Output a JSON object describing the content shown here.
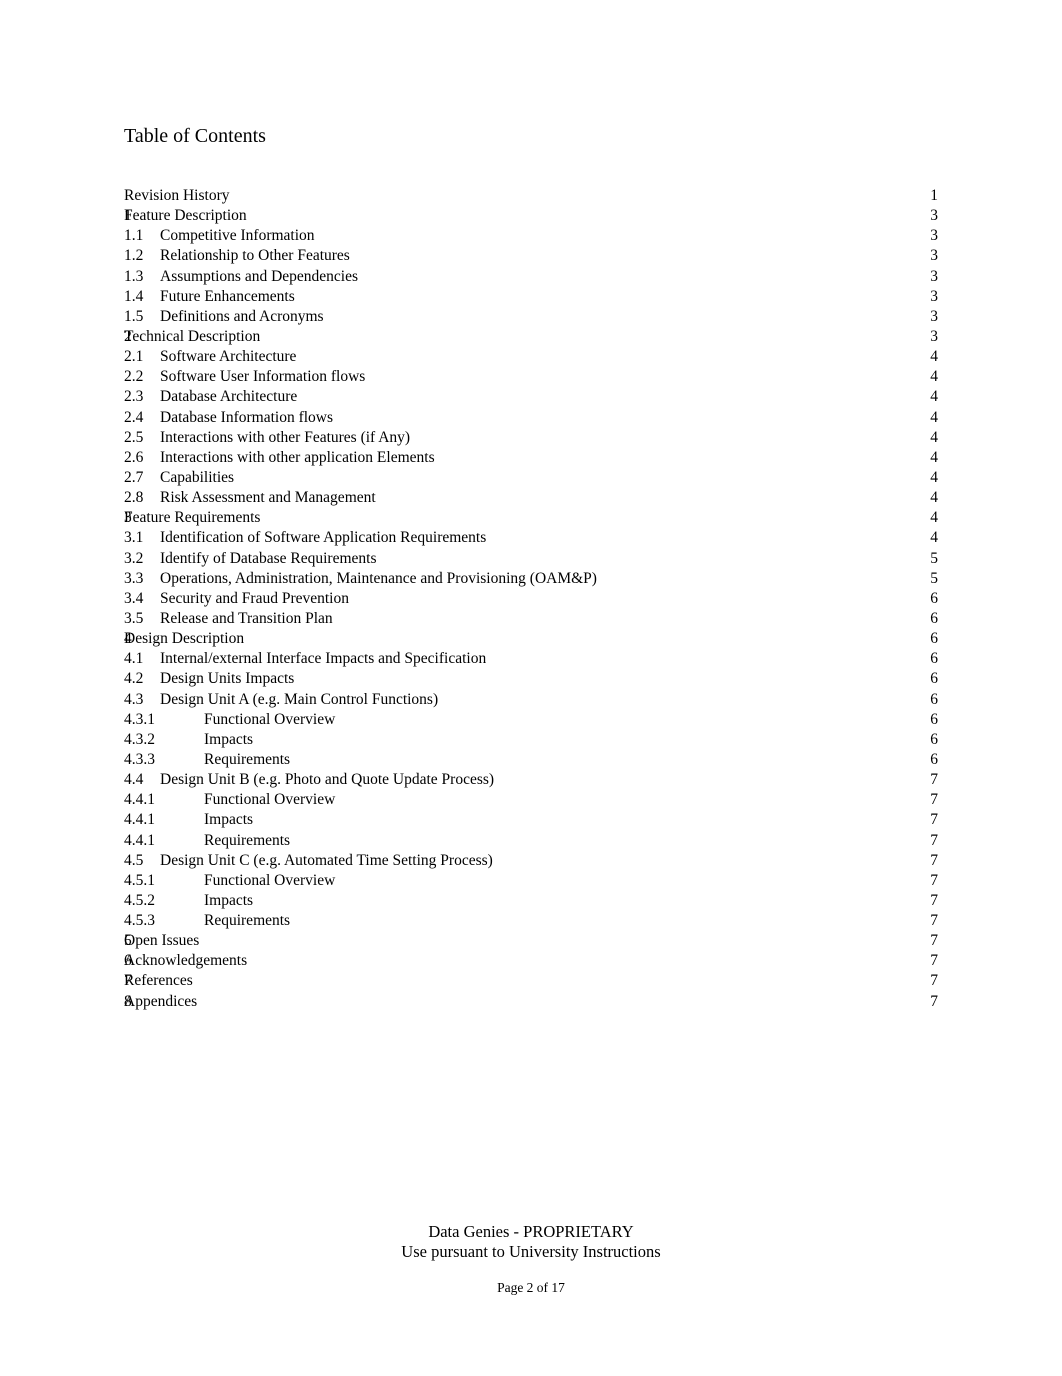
{
  "document": {
    "title": "Table of Contents"
  },
  "toc": {
    "entries": [
      {
        "number": "",
        "label": "Revision History",
        "page": "1",
        "level": 0
      },
      {
        "number": "1",
        "label": "Feature Description",
        "page": "3",
        "level": 0
      },
      {
        "number": "1.1",
        "label": "Competitive Information",
        "page": "3",
        "level": 1
      },
      {
        "number": "1.2",
        "label": "Relationship to Other Features",
        "page": "3",
        "level": 1
      },
      {
        "number": "1.3",
        "label": "Assumptions and Dependencies",
        "page": "3",
        "level": 1
      },
      {
        "number": "1.4",
        "label": "Future Enhancements",
        "page": "3",
        "level": 1
      },
      {
        "number": "1.5",
        "label": "Definitions and Acronyms",
        "page": "3",
        "level": 1
      },
      {
        "number": "2",
        "label": "Technical Description",
        "page": "3",
        "level": 0
      },
      {
        "number": "2.1",
        "label": "Software Architecture",
        "page": "4",
        "level": 1
      },
      {
        "number": "2.2",
        "label": "Software User Information flows",
        "page": "4",
        "level": 1
      },
      {
        "number": "2.3",
        "label": "Database Architecture",
        "page": "4",
        "level": 1
      },
      {
        "number": "2.4",
        "label": "Database Information flows",
        "page": "4",
        "level": 1
      },
      {
        "number": "2.5",
        "label": "Interactions with other Features (if Any)",
        "page": "4",
        "level": 1
      },
      {
        "number": "2.6",
        "label": "Interactions with other application Elements",
        "page": "4",
        "level": 1
      },
      {
        "number": "2.7",
        "label": "Capabilities",
        "page": "4",
        "level": 1
      },
      {
        "number": "2.8",
        "label": "Risk Assessment and Management",
        "page": "4",
        "level": 1
      },
      {
        "number": "3",
        "label": "Feature Requirements",
        "page": "4",
        "level": 0
      },
      {
        "number": "3.1",
        "label": "Identification of Software Application Requirements",
        "page": "4",
        "level": 1
      },
      {
        "number": "3.2",
        "label": "Identify of Database Requirements",
        "page": "5",
        "level": 1
      },
      {
        "number": "3.3",
        "label": "Operations, Administration, Maintenance and Provisioning (OAM&P)",
        "page": "5",
        "level": 1
      },
      {
        "number": "3.4",
        "label": "Security and Fraud Prevention",
        "page": "6",
        "level": 1
      },
      {
        "number": "3.5",
        "label": "Release and Transition Plan",
        "page": "6",
        "level": 1
      },
      {
        "number": "4",
        "label": "Design Description",
        "page": "6",
        "level": 0
      },
      {
        "number": "4.1",
        "label": "Internal/external Interface Impacts and Specification",
        "page": "6",
        "level": 1
      },
      {
        "number": "4.2",
        "label": "Design Units Impacts",
        "page": "6",
        "level": 1
      },
      {
        "number": "4.3",
        "label": "Design Unit A (e.g. Main Control Functions)",
        "page": "6",
        "level": 1
      },
      {
        "number": "4.3.1",
        "label": "Functional Overview",
        "page": "6",
        "level": 2
      },
      {
        "number": "4.3.2",
        "label": "Impacts",
        "page": "6",
        "level": 2
      },
      {
        "number": "4.3.3",
        "label": "Requirements",
        "page": "6",
        "level": 2
      },
      {
        "number": "4.4",
        "label": "Design Unit B (e.g. Photo and Quote Update Process)",
        "page": "7",
        "level": 1
      },
      {
        "number": "4.4.1",
        "label": "Functional Overview",
        "page": "7",
        "level": 2
      },
      {
        "number": "4.4.1",
        "label": "Impacts",
        "page": "7",
        "level": 2
      },
      {
        "number": "4.4.1",
        "label": "Requirements",
        "page": "7",
        "level": 2
      },
      {
        "number": "4.5",
        "label": "Design Unit C (e.g. Automated Time Setting Process)",
        "page": "7",
        "level": 1
      },
      {
        "number": "4.5.1",
        "label": "Functional Overview",
        "page": "7",
        "level": 2
      },
      {
        "number": "4.5.2",
        "label": "Impacts",
        "page": "7",
        "level": 2
      },
      {
        "number": "4.5.3",
        "label": "Requirements",
        "page": "7",
        "level": 2
      },
      {
        "number": "5",
        "label": "Open Issues",
        "page": "7",
        "level": 0
      },
      {
        "number": "6",
        "label": "Acknowledgements",
        "page": "7",
        "level": 0
      },
      {
        "number": "7",
        "label": "References",
        "page": "7",
        "level": 0
      },
      {
        "number": "8",
        "label": "Appendices",
        "page": "7",
        "level": 0
      }
    ]
  },
  "footer": {
    "line1": "Data Genies - PROPRIETARY",
    "line2": "Use pursuant to University Instructions",
    "page_indicator": "Page 2 of 17"
  }
}
